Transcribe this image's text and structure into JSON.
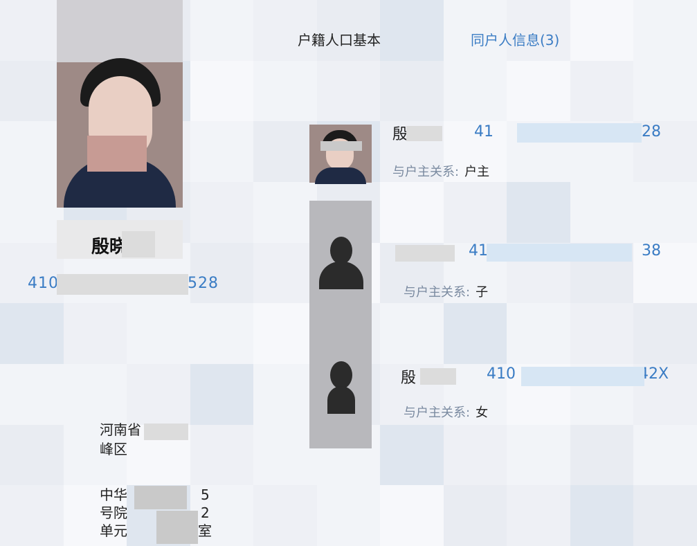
{
  "tabs": {
    "basic": "户籍人口基本",
    "household": "同户人信息(3)"
  },
  "profile": {
    "name": "殷晓",
    "id_number": "410",
    "id_suffix": "528"
  },
  "address": {
    "line1": "河南省",
    "line2": "峰区",
    "line3_a": "中华",
    "line3_b": "5",
    "line4_a": "号院",
    "line4_b": "2",
    "line5_a": "单元",
    "line5_b": "室"
  },
  "members": [
    {
      "name": "殷晓",
      "id_prefix": "41",
      "id_suffix": "28",
      "relation_label": "与户主关系:",
      "relation_value": "户主",
      "avatar": "photo"
    },
    {
      "name": "",
      "id_prefix": "41",
      "id_suffix": "38",
      "relation_label": "与户主关系:",
      "relation_value": "子",
      "avatar": "silhouette-icon"
    },
    {
      "name": "殷",
      "id_prefix": "410",
      "id_suffix": "42X",
      "relation_label": "与户主关系:",
      "relation_value": "女",
      "avatar": "silhouette-icon"
    }
  ]
}
